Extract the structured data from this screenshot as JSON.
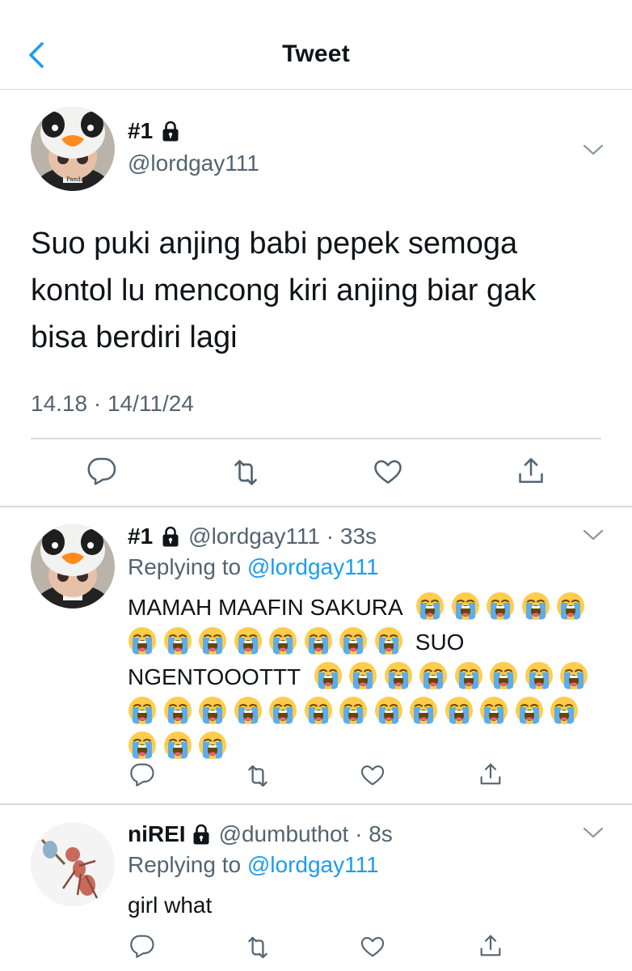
{
  "header": {
    "title": "Tweet"
  },
  "main_tweet": {
    "display_name": "#1",
    "handle": "@lordgay111",
    "text": "Suo puki anjing babi pepek semoga kontol lu mencong kiri anjing biar gak bisa berdiri lagi",
    "timestamp": "14.18 · 14/11/24",
    "avatar_caption": "Panda"
  },
  "replies": [
    {
      "display_name": "#1",
      "handle": "@lordgay111",
      "time": "33s",
      "replying_prefix": "Replying to ",
      "replying_to": "@lordgay111",
      "text_part1": "MAMAH MAAFIN SAKURA",
      "emoji_run1": 13,
      "text_part2": "SUO NGENTOOOTTT",
      "emoji_run2": 24,
      "emoji_name": "loudly-crying-face"
    },
    {
      "display_name": "niREI",
      "handle": "@dumbuthot",
      "time": "8s",
      "replying_prefix": "Replying to ",
      "replying_to": "@lordgay111",
      "text": "girl what"
    }
  ],
  "colors": {
    "accent": "#1d9bf0",
    "secondary_text": "#536471",
    "divider": "#d6dbe0",
    "icon": "#536471"
  }
}
